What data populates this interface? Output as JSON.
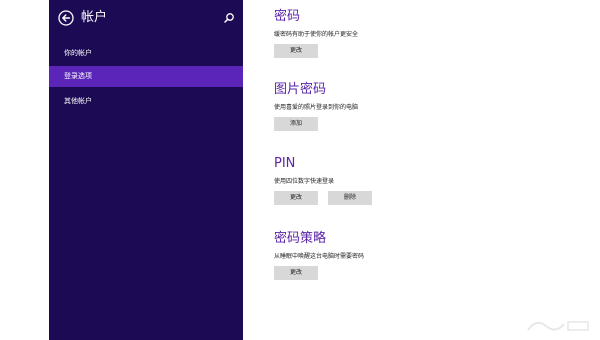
{
  "sidebar": {
    "title": "帐户",
    "items": [
      {
        "label": "你的帐户",
        "active": false
      },
      {
        "label": "登录选项",
        "active": true
      },
      {
        "label": "其他帐户",
        "active": false
      }
    ]
  },
  "sections": [
    {
      "title": "密码",
      "desc": "缓密码有助于使你的帐户更安全",
      "buttons": [
        "更改"
      ]
    },
    {
      "title": "图片密码",
      "desc": "使用喜爱的照片登录到你的电脑",
      "buttons": [
        "添加"
      ]
    },
    {
      "title": "PIN",
      "desc": "使用四位数字快速登录",
      "buttons": [
        "更改",
        "删除"
      ]
    },
    {
      "title": "密码策略",
      "desc": "从睡眠中唤醒这台电脑时需要密码",
      "buttons": [
        "更改"
      ]
    }
  ],
  "colors": {
    "sidebar_bg": "#1c0a54",
    "active_item_bg": "#5a25b8",
    "section_title": "#5a25a8",
    "button_bg": "#d8d8d8"
  },
  "icons": {
    "back": "back-arrow-circle-icon",
    "search": "search-icon"
  }
}
